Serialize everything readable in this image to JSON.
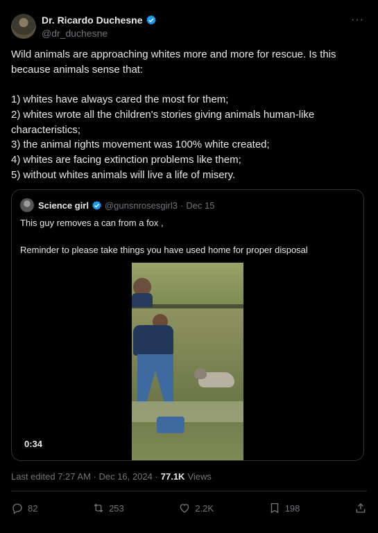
{
  "author": {
    "display_name": "Dr. Ricardo Duchesne",
    "handle": "@dr_duchesne",
    "verified_color": "#1d9bf0"
  },
  "more_icon": "···",
  "tweet_text": "Wild animals are approaching whites more and more for rescue. Is this because animals sense that:\n\n1) whites have always cared the most for them;\n2) whites wrote all the children's stories giving animals human-like characteristics;\n3) the animal rights movement was 100% white created;\n4) whites are facing extinction problems like them;\n5) without whites animals will live a life of misery.",
  "quote": {
    "display_name": "Science girl",
    "handle": "@gunsnrosesgirl3",
    "separator": "·",
    "date": "Dec 15",
    "text": "This guy removes a can from a fox ,\n\nReminder to please take things you have used home for proper disposal",
    "video_duration": "0:34"
  },
  "meta": {
    "edited": "Last edited 7:27 AM · Dec 16, 2024 ·",
    "views_count": "77.1K",
    "views_label": "Views"
  },
  "actions": {
    "replies": "82",
    "reposts": "253",
    "likes": "2.2K",
    "bookmarks": "198"
  }
}
